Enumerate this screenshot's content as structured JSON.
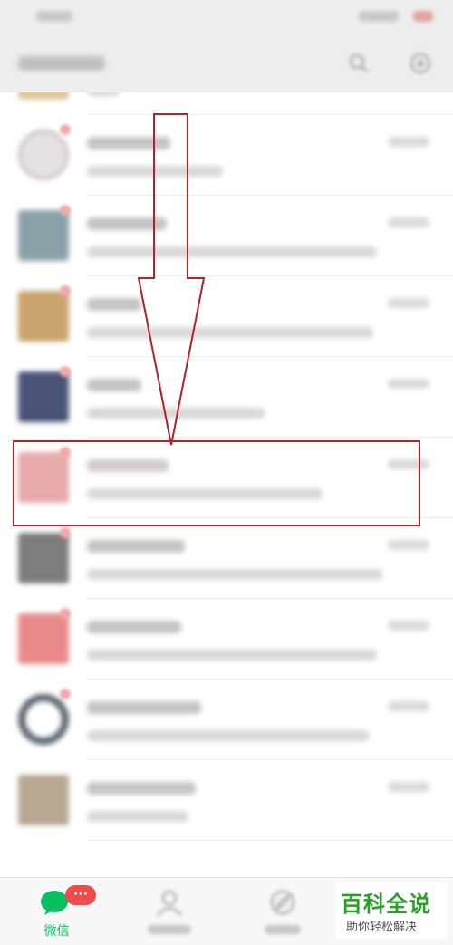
{
  "colors": {
    "accent": "#07c160",
    "annotation": "#b5202a",
    "badge": "#f04b4b",
    "header_bg": "#ededed",
    "tabbar_bg": "#f7f7f7"
  },
  "header": {
    "search_icon": "search-icon",
    "add_icon": "plus-circle-icon"
  },
  "tabbar": {
    "tabs": [
      {
        "label": "微信",
        "icon": "chat-bubble-icon",
        "active": true,
        "badge": "···"
      },
      {
        "label": "",
        "icon": "contacts-icon",
        "active": false
      },
      {
        "label": "",
        "icon": "discover-icon",
        "active": false
      },
      {
        "label": "",
        "icon": "me-icon",
        "active": false
      }
    ]
  },
  "annotation": {
    "arrow": "down-arrow",
    "highlight": "highlighted-chat-row",
    "highlighted_row_index": 4
  },
  "watermark": {
    "title": "百科全说",
    "subtitle": "助你轻松解决"
  }
}
